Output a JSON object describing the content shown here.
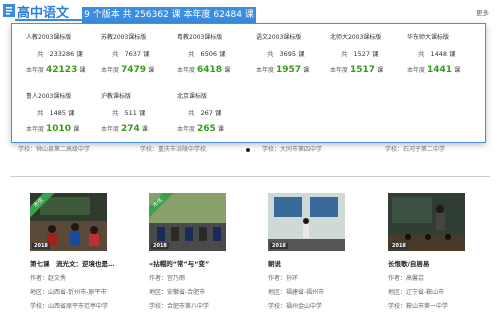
{
  "header": {
    "title": "高中语文",
    "stats": "9 个版本  共 256362 课  本年度 62484 课",
    "more": "更多"
  },
  "editions": [
    {
      "name": "人教2003课标版",
      "total_label": "共",
      "total": "233286",
      "total_unit": "课",
      "year_label": "本年度",
      "year": "42123",
      "year_unit": "课"
    },
    {
      "name": "苏教2003课标版",
      "total_label": "共",
      "total": "7637",
      "total_unit": "课",
      "year_label": "本年度",
      "year": "7479",
      "year_unit": "课"
    },
    {
      "name": "粤教2003课标版",
      "total_label": "共",
      "total": "6506",
      "total_unit": "课",
      "year_label": "本年度",
      "year": "6418",
      "year_unit": "课"
    },
    {
      "name": "语文2003课标版",
      "total_label": "共",
      "total": "3695",
      "total_unit": "课",
      "year_label": "本年度",
      "year": "1957",
      "year_unit": "课"
    },
    {
      "name": "北师大2003课标版",
      "total_label": "共",
      "total": "1527",
      "total_unit": "课",
      "year_label": "本年度",
      "year": "1517",
      "year_unit": "课"
    },
    {
      "name": "华东师大课标版",
      "total_label": "共",
      "total": "1448",
      "total_unit": "课",
      "year_label": "本年度",
      "year": "1441",
      "year_unit": "课"
    },
    {
      "name": "鲁人2003课标版",
      "total_label": "共",
      "total": "1485",
      "total_unit": "课",
      "year_label": "本年度",
      "year": "1010",
      "year_unit": "课"
    },
    {
      "name": "沪教课标版",
      "total_label": "共",
      "total": "511",
      "total_unit": "课",
      "year_label": "本年度",
      "year": "274",
      "year_unit": "课"
    },
    {
      "name": "北京课标版",
      "total_label": "共",
      "total": "267",
      "total_unit": "课",
      "year_label": "本年度",
      "year": "265",
      "year_unit": "课"
    }
  ],
  "background_row": [
    "学校：钟山县第二高级中学",
    "学校：重庆市涪陵中学校",
    "学校：大同市第四中学",
    "学校：石河子第二中学"
  ],
  "cards": [
    {
      "ribbon": "市优",
      "year": "2018",
      "title": "第七课　流光文：逆境也是…",
      "author": "作者：赵文秀",
      "region": "地区：山西省-忻州市-原平市",
      "school": "学校：山西省原平市范亭中学"
    },
    {
      "ribbon": "市优",
      "year": "2018",
      "title": "«拈帽的“常”与“变”",
      "author": "作者：宫乃雨",
      "region": "地区：安徽省-合肥市",
      "school": "学校：合肥市第八中学"
    },
    {
      "ribbon": "",
      "year": "2018",
      "title": "朝说",
      "author": "作者：孙环",
      "region": "地区：福建省-福州市",
      "school": "学校：福州金山中学"
    },
    {
      "ribbon": "",
      "year": "2018",
      "title": "长恨歌/自居易",
      "author": "作者：高馨芸",
      "region": "地区：辽宁省-鞍山市",
      "school": "学校：鞍山市第一中学"
    }
  ],
  "colors": {
    "accent": "#3b8de0",
    "green": "#3a9a20"
  }
}
